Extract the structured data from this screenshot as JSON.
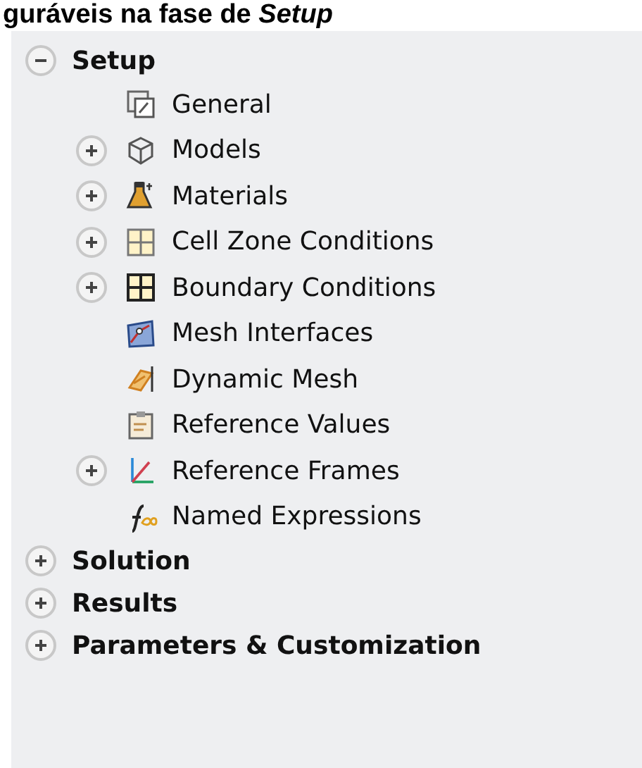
{
  "caption": "guráveis na fase de *Setup*",
  "tree": [
    {
      "label": "Setup",
      "kind": "group",
      "expanded": true,
      "children": [
        {
          "label": "General",
          "kind": "leaf"
        },
        {
          "label": "Models",
          "kind": "group",
          "expanded": false
        },
        {
          "label": "Materials",
          "kind": "group",
          "expanded": false
        },
        {
          "label": "Cell Zone Conditions",
          "kind": "group",
          "expanded": false
        },
        {
          "label": "Boundary Conditions",
          "kind": "group",
          "expanded": false
        },
        {
          "label": "Mesh Interfaces",
          "kind": "leaf"
        },
        {
          "label": "Dynamic Mesh",
          "kind": "leaf"
        },
        {
          "label": "Reference Values",
          "kind": "leaf"
        },
        {
          "label": "Reference Frames",
          "kind": "group",
          "expanded": false
        },
        {
          "label": "Named Expressions",
          "kind": "leaf"
        }
      ]
    },
    {
      "label": "Solution",
      "kind": "group",
      "expanded": false
    },
    {
      "label": "Results",
      "kind": "group",
      "expanded": false
    },
    {
      "label": "Parameters & Customization",
      "kind": "group",
      "expanded": false
    }
  ]
}
